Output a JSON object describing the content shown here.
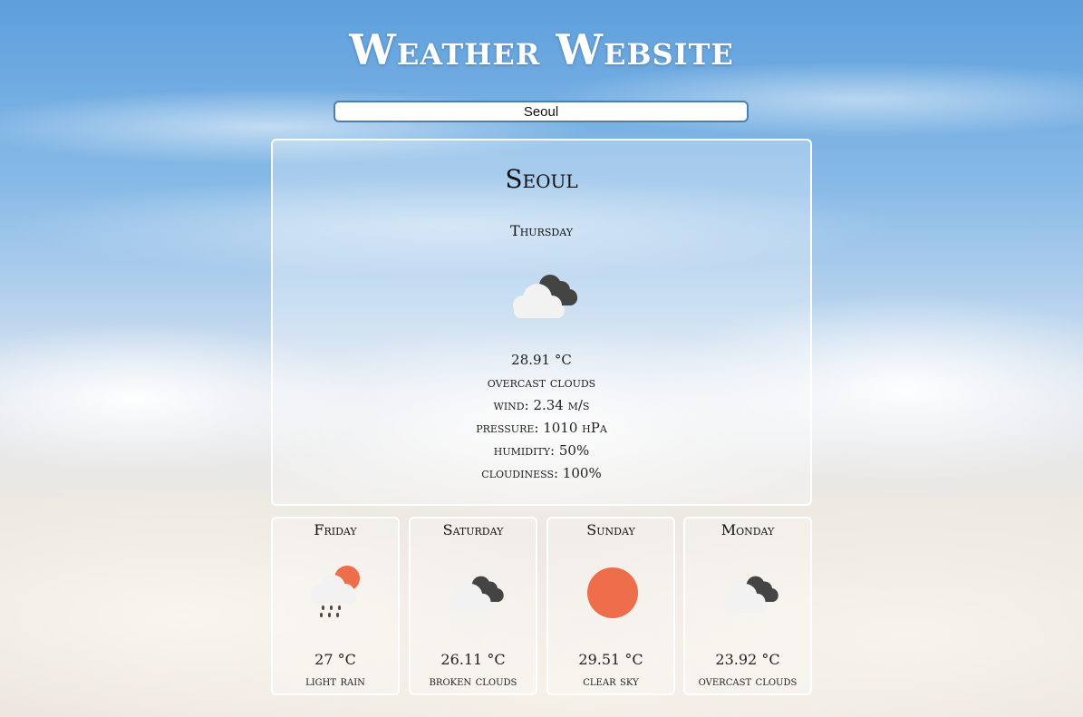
{
  "header": {
    "title": "Weather Website"
  },
  "search": {
    "value": "Seoul"
  },
  "current": {
    "city": "Seoul",
    "day": "Thursday",
    "icon": "overcast-clouds-icon",
    "temp": "28.91 °C",
    "description": "overcast clouds",
    "wind": "wind: 2.34 m/s",
    "pressure": "pressure: 1010 hPa",
    "humidity": "humidity: 50%",
    "cloudiness": "cloudiness: 100%"
  },
  "forecast": [
    {
      "day": "Friday",
      "icon": "light-rain-icon",
      "temp": "27 °C",
      "description": "light rain"
    },
    {
      "day": "Saturday",
      "icon": "broken-clouds-icon",
      "temp": "26.11 °C",
      "description": "broken clouds"
    },
    {
      "day": "Sunday",
      "icon": "sun-icon",
      "temp": "29.51 °C",
      "description": "clear sky"
    },
    {
      "day": "Monday",
      "icon": "overcast-clouds-icon",
      "temp": "23.92 °C",
      "description": "overcast clouds"
    }
  ],
  "colors": {
    "sun": "#ee6d4a",
    "dark_cloud": "#444444",
    "light_cloud": "#f2f2f2",
    "search_border": "#4a7fae"
  }
}
